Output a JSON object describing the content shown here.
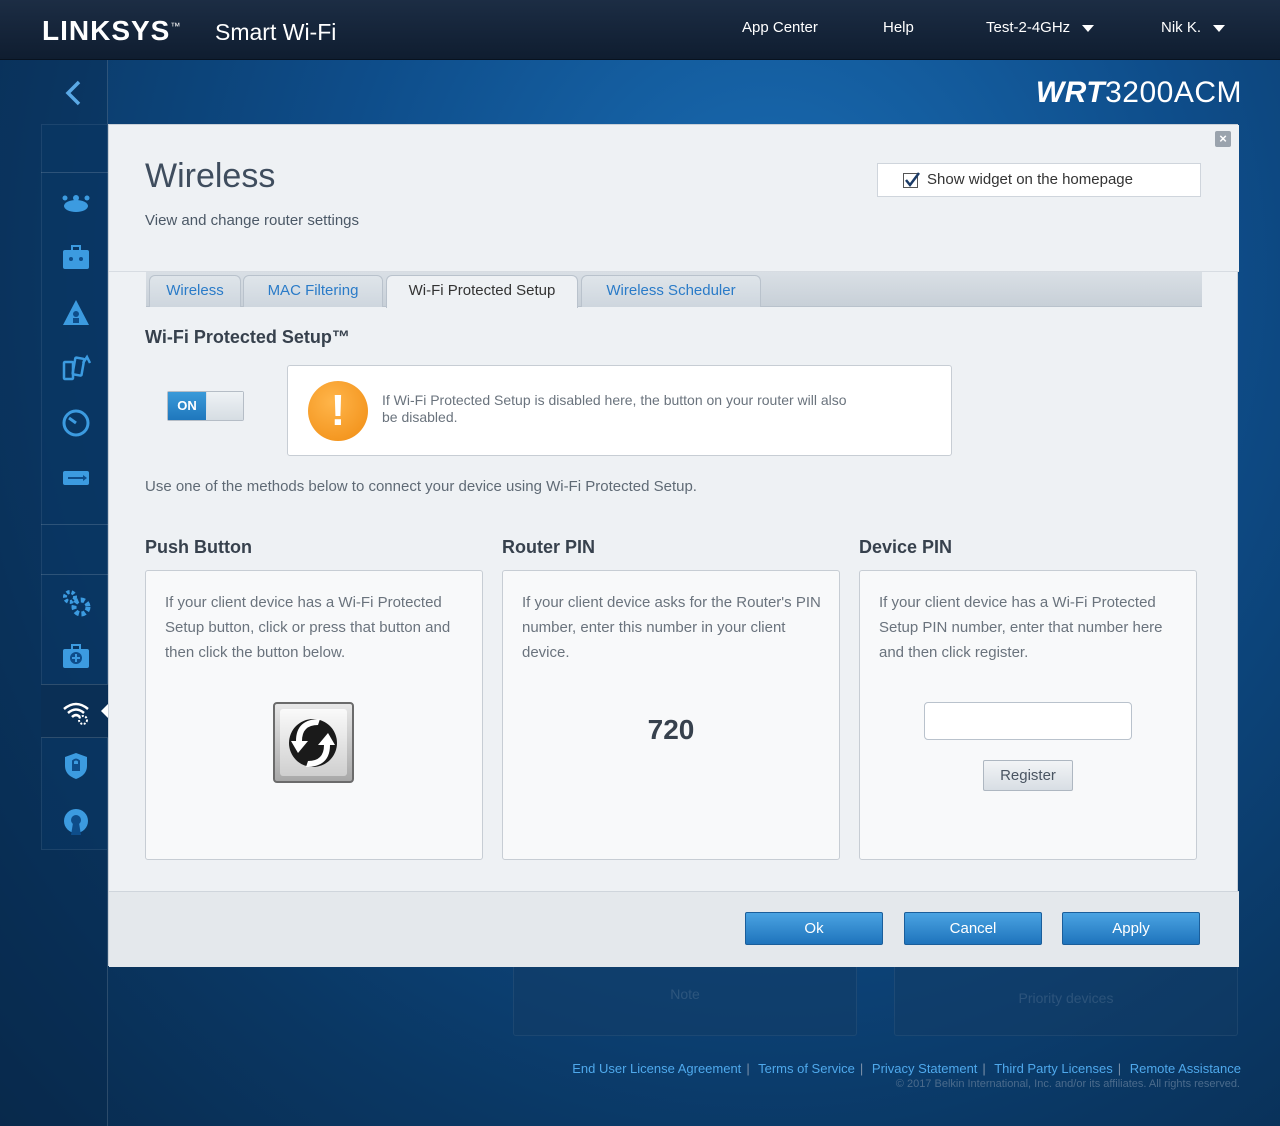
{
  "brand": {
    "logo": "LINKSYS",
    "trademark": "™",
    "product": "Smart Wi-Fi",
    "model_prefix": "WRT",
    "model_number": "3200ACM"
  },
  "topnav": {
    "app_center": "App Center",
    "help": "Help",
    "network": "Test-2-4GHz",
    "user": "Nik K."
  },
  "modal": {
    "title": "Wireless",
    "subtitle": "View and change router settings",
    "widget_label": "Show widget on the homepage",
    "widget_checked": true,
    "close": "×"
  },
  "tabs": [
    {
      "label": "Wireless",
      "active": false
    },
    {
      "label": "MAC Filtering",
      "active": false
    },
    {
      "label": "Wi-Fi Protected Setup",
      "active": true
    },
    {
      "label": "Wireless Scheduler",
      "active": false
    }
  ],
  "wps": {
    "section_title": "Wi-Fi Protected Setup™",
    "toggle_label": "ON",
    "toggle_state": "on",
    "warning_icon": "!",
    "warning": "If Wi-Fi Protected Setup is disabled here, the button on your router will also be disabled.",
    "instructions": "Use one of the methods below to connect your device using Wi-Fi Protected Setup.",
    "push_button": {
      "title": "Push Button",
      "text": "If your client device has a Wi-Fi Protected Setup button, click or press that button and then click the button below."
    },
    "router_pin": {
      "title": "Router PIN",
      "text": "If your client device asks for the Router's PIN number, enter this number in your client device.",
      "pin": "720"
    },
    "device_pin": {
      "title": "Device PIN",
      "text": "If your client device has a Wi-Fi Protected Setup PIN number, enter that number here and then click register.",
      "input_value": "",
      "register": "Register"
    }
  },
  "footer_buttons": {
    "ok": "Ok",
    "cancel": "Cancel",
    "apply": "Apply"
  },
  "background_cards": {
    "left": "Note",
    "right": "Priority devices"
  },
  "footer": {
    "links": [
      "End User License Agreement",
      "Terms of Service",
      "Privacy Statement",
      "Third Party Licenses",
      "Remote Assistance"
    ],
    "copyright": "© 2017 Belkin International, Inc. and/or its affiliates. All rights reserved."
  },
  "sidebar_icons": [
    "network-map-icon",
    "guest-access-icon",
    "parental-controls-icon",
    "media-prioritization-icon",
    "speed-test-icon",
    "external-storage-icon",
    "connectivity-icon",
    "troubleshooting-icon",
    "wireless-icon",
    "security-icon",
    "openvpn-icon"
  ],
  "colors": {
    "link_blue": "#2a7bc8",
    "button_blue": "#1f74bc",
    "warning_orange": "#f08c12",
    "background_blue": "#0e4d8a"
  }
}
